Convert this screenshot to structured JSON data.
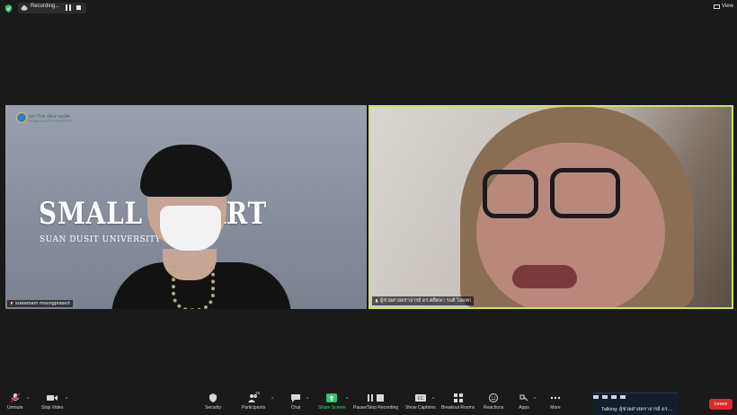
{
  "top_bar": {
    "recording_label": "Recording...",
    "view_label": "View"
  },
  "tiles": {
    "left": {
      "participant_name": "suwamarn moungprasert",
      "slide": {
        "org_name": "มหาวิทยาลัยสวนดุสิต",
        "org_name_en": "SUAN DUSIT UNIVERSITY",
        "title": "SMALL BU      ART",
        "subtitle": "SUAN DUSIT UNIVERSITY (SDU)"
      }
    },
    "right": {
      "participant_name": "ผู้ช่วยศาสตราจารย์ ดร.ศศิตพา รอดี ไสผทก",
      "active_speaker_color": "#c8e46a"
    }
  },
  "toolbar": {
    "unmute": "Unmute",
    "stop_video": "Stop Video",
    "security": "Security",
    "participants": "Participants",
    "participants_count": "25",
    "chat": "Chat",
    "share_screen": "Share Screen",
    "pause_stop_recording": "Pause/Stop Recording",
    "show_captions": "Show Captions",
    "breakout_rooms": "Breakout Rooms",
    "reactions": "Reactions",
    "apps": "Apps",
    "more": "More",
    "leave": "Leave"
  },
  "talking": {
    "text": "Talking: ผู้ช่วยศาสตราจารย์ ดร...."
  },
  "colors": {
    "background": "#1a1a1a",
    "share_green": "#2fc36e",
    "leave_red": "#e02828"
  }
}
